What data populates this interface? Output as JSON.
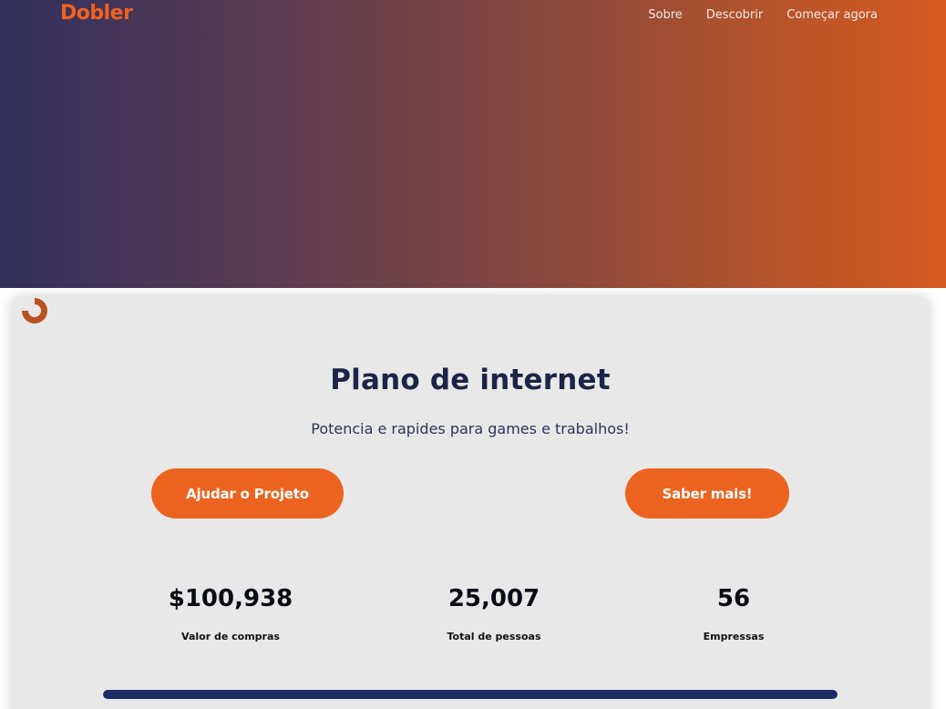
{
  "header": {
    "logo": "Dobler",
    "nav": [
      "Sobre",
      "Descobrir",
      "Começar agora"
    ]
  },
  "card": {
    "title": "Plano de internet",
    "subtitle": "Potencia e rapides para games e trabalhos!",
    "buttons": {
      "help_label": "Ajudar o Projeto",
      "more_label": "Saber mais!"
    },
    "stats": [
      {
        "value": "$100,938",
        "label": "Valor de compras"
      },
      {
        "value": "25,007",
        "label": "Total de pessoas"
      },
      {
        "value": "56",
        "label": "Empressas"
      }
    ],
    "progress": 1.0
  },
  "icons": {
    "loader": "loader-icon"
  },
  "colors": {
    "accent": "#ec631f",
    "title": "#1d2447",
    "progress": "#1c2a66",
    "gradient_start": "#32305c",
    "gradient_end": "#d65a20"
  }
}
